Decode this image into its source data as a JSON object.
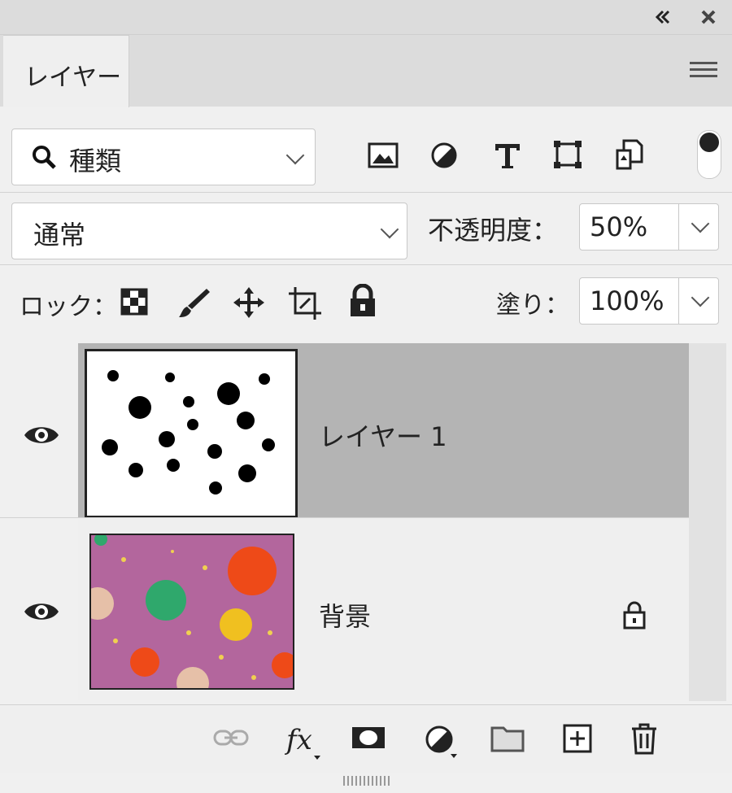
{
  "topbar": {
    "collapse_icon": "double-chevron-left-icon",
    "close_icon": "close-icon"
  },
  "tabs": [
    {
      "label": "レイヤー"
    }
  ],
  "filter": {
    "kind_label": "種類",
    "icons": [
      "image-filter-icon",
      "adjustment-filter-icon",
      "type-filter-icon",
      "shape-filter-icon",
      "smart-object-filter-icon"
    ]
  },
  "blend": {
    "mode": "通常",
    "opacity_label": "不透明度：",
    "opacity_value": "50%"
  },
  "lock": {
    "label": "ロック：",
    "fill_label": "塗り：",
    "fill_value": "100%"
  },
  "layers": [
    {
      "name": "レイヤー 1",
      "selected": true,
      "visible": true,
      "locked": false
    },
    {
      "name": "背景",
      "selected": false,
      "visible": true,
      "locked": true
    }
  ],
  "colors": {
    "panel_bg": "#f0f0f0",
    "selected_row": "#b4b4b4",
    "background_fabric": "#b86aa0"
  }
}
